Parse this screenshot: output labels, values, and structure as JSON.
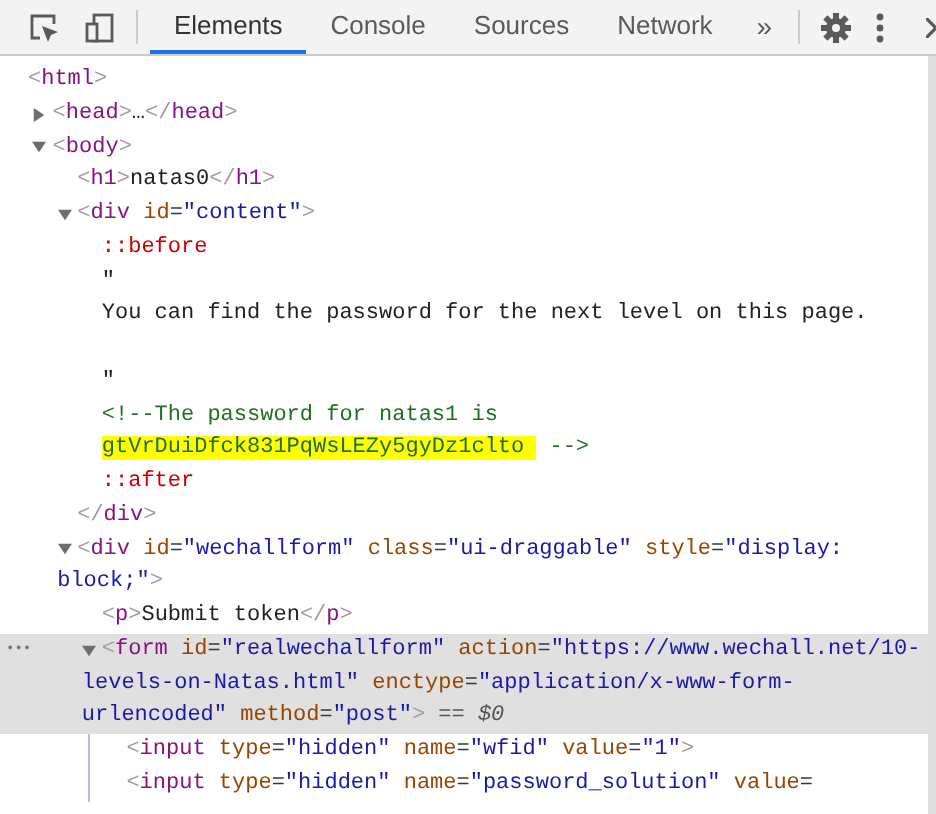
{
  "toolbar": {
    "tabs": [
      {
        "label": "Elements",
        "selected": true
      },
      {
        "label": "Console",
        "selected": false
      },
      {
        "label": "Sources",
        "selected": false
      },
      {
        "label": "Network",
        "selected": false
      }
    ],
    "overflow": "»"
  },
  "tree": [
    {
      "selected": false,
      "lines": [
        [
          {
            "kind": "punct",
            "text": "<"
          },
          {
            "kind": "tag",
            "text": "html"
          },
          {
            "kind": "punct",
            "text": ">"
          }
        ]
      ],
      "children": [
        {
          "selected": false,
          "expanded": false,
          "lines": [
            [
              {
                "kind": "punct",
                "text": "<"
              },
              {
                "kind": "tag",
                "text": "head"
              },
              {
                "kind": "punct",
                "text": ">"
              },
              {
                "kind": "text",
                "text": "…"
              },
              {
                "kind": "punct",
                "text": "</"
              },
              {
                "kind": "tag",
                "text": "head"
              },
              {
                "kind": "punct",
                "text": ">"
              }
            ]
          ]
        },
        {
          "selected": false,
          "expanded": true,
          "lines": [
            [
              {
                "kind": "punct",
                "text": "<"
              },
              {
                "kind": "tag",
                "text": "body"
              },
              {
                "kind": "punct",
                "text": ">"
              }
            ]
          ],
          "children": [
            {
              "selected": false,
              "lines": [
                [
                  {
                    "kind": "punct",
                    "text": "<"
                  },
                  {
                    "kind": "tag",
                    "text": "h1"
                  },
                  {
                    "kind": "punct",
                    "text": ">"
                  },
                  {
                    "kind": "text",
                    "text": "natas0"
                  },
                  {
                    "kind": "punct",
                    "text": "</"
                  },
                  {
                    "kind": "tag",
                    "text": "h1"
                  },
                  {
                    "kind": "punct",
                    "text": ">"
                  }
                ]
              ]
            },
            {
              "selected": false,
              "expanded": true,
              "lines": [
                [
                  {
                    "kind": "punct",
                    "text": "<"
                  },
                  {
                    "kind": "tag",
                    "text": "div "
                  },
                  {
                    "kind": "attr",
                    "text": "id"
                  },
                  {
                    "kind": "eq",
                    "text": "="
                  },
                  {
                    "kind": "value",
                    "text": "\"content\""
                  },
                  {
                    "kind": "punct",
                    "text": ">"
                  }
                ]
              ],
              "children": [
                {
                  "selected": false,
                  "lines": [
                    [
                      {
                        "kind": "pseudo",
                        "text": "::before"
                      }
                    ]
                  ]
                },
                {
                  "selected": false,
                  "trailing_newline": true,
                  "lines": [
                    [
                      {
                        "kind": "text",
                        "text": "\""
                      }
                    ],
                    [
                      {
                        "kind": "text",
                        "text": "You can find the password for the next level on this page."
                      }
                    ],
                    [
                      {
                        "kind": "text",
                        "text": "\""
                      }
                    ]
                  ]
                },
                {
                  "selected": false,
                  "lines": [
                    [
                      {
                        "kind": "comment",
                        "text": "<!--The password for natas1 is"
                      }
                    ],
                    [
                      {
                        "kind": "comment",
                        "text": "gtVrDuiDfck831PqWsLEZy5gyDz1clto",
                        "highlighted": true
                      },
                      {
                        "kind": "comment",
                        "text": " -->"
                      }
                    ]
                  ]
                },
                {
                  "selected": false,
                  "lines": [
                    [
                      {
                        "kind": "pseudo",
                        "text": "::after"
                      }
                    ]
                  ]
                }
              ],
              "closing": [
                {
                  "kind": "punct",
                  "text": "</"
                },
                {
                  "kind": "tag",
                  "text": "div"
                },
                {
                  "kind": "punct",
                  "text": ">"
                }
              ]
            },
            {
              "selected": false,
              "expanded": true,
              "lines": [
                [
                  {
                    "kind": "punct",
                    "text": "<"
                  },
                  {
                    "kind": "tag",
                    "text": "div "
                  },
                  {
                    "kind": "attr",
                    "text": "id"
                  },
                  {
                    "kind": "eq",
                    "text": "="
                  },
                  {
                    "kind": "value",
                    "text": "\"wechallform\" "
                  },
                  {
                    "kind": "attr",
                    "text": "class"
                  },
                  {
                    "kind": "eq",
                    "text": "="
                  },
                  {
                    "kind": "value",
                    "text": "\"ui-draggable\" "
                  },
                  {
                    "kind": "attr",
                    "text": "style"
                  },
                  {
                    "kind": "eq",
                    "text": "="
                  },
                  {
                    "kind": "value",
                    "text": "\"display:"
                  }
                ],
                [
                  {
                    "kind": "value",
                    "text": "block;\""
                  },
                  {
                    "kind": "punct",
                    "text": ">"
                  }
                ]
              ],
              "children": [
                {
                  "selected": false,
                  "lines": [
                    [
                      {
                        "kind": "punct",
                        "text": "<"
                      },
                      {
                        "kind": "tag",
                        "text": "p"
                      },
                      {
                        "kind": "punct",
                        "text": ">"
                      },
                      {
                        "kind": "text",
                        "text": "Submit token"
                      },
                      {
                        "kind": "punct",
                        "text": "</"
                      },
                      {
                        "kind": "tag",
                        "text": "p"
                      },
                      {
                        "kind": "punct",
                        "text": ">"
                      }
                    ]
                  ]
                },
                {
                  "selected": true,
                  "expanded": true,
                  "more": "•••",
                  "lines": [
                    [
                      {
                        "kind": "punct",
                        "text": "<"
                      },
                      {
                        "kind": "tag",
                        "text": "form "
                      },
                      {
                        "kind": "attr",
                        "text": "id"
                      },
                      {
                        "kind": "eq",
                        "text": "="
                      },
                      {
                        "kind": "value",
                        "text": "\"realwechallform\" "
                      },
                      {
                        "kind": "attr",
                        "text": "action"
                      },
                      {
                        "kind": "eq",
                        "text": "="
                      },
                      {
                        "kind": "value",
                        "text": "\"https://www.wechall.net/10-"
                      }
                    ],
                    [
                      {
                        "kind": "value",
                        "text": "levels-on-Natas.html\" "
                      },
                      {
                        "kind": "attr",
                        "text": "enctype"
                      },
                      {
                        "kind": "eq",
                        "text": "="
                      },
                      {
                        "kind": "value",
                        "text": "\"application/x-www-form-"
                      }
                    ],
                    [
                      {
                        "kind": "value",
                        "text": "urlencoded\" "
                      },
                      {
                        "kind": "attr",
                        "text": "method"
                      },
                      {
                        "kind": "eq",
                        "text": "="
                      },
                      {
                        "kind": "value",
                        "text": "\"post\""
                      },
                      {
                        "kind": "punct",
                        "text": ">"
                      },
                      {
                        "kind": "hint",
                        "text": " == "
                      },
                      {
                        "kind": "var",
                        "text": "$0"
                      }
                    ]
                  ],
                  "children": [
                    {
                      "selected": false,
                      "lines": [
                        [
                          {
                            "kind": "punct",
                            "text": "<"
                          },
                          {
                            "kind": "tag",
                            "text": "input "
                          },
                          {
                            "kind": "attr",
                            "text": "type"
                          },
                          {
                            "kind": "eq",
                            "text": "="
                          },
                          {
                            "kind": "value",
                            "text": "\"hidden\" "
                          },
                          {
                            "kind": "attr",
                            "text": "name"
                          },
                          {
                            "kind": "eq",
                            "text": "="
                          },
                          {
                            "kind": "value",
                            "text": "\"wfid\" "
                          },
                          {
                            "kind": "attr",
                            "text": "value"
                          },
                          {
                            "kind": "eq",
                            "text": "="
                          },
                          {
                            "kind": "value",
                            "text": "\"1\""
                          },
                          {
                            "kind": "punct",
                            "text": ">"
                          }
                        ]
                      ]
                    },
                    {
                      "selected": false,
                      "lines": [
                        [
                          {
                            "kind": "punct",
                            "text": "<"
                          },
                          {
                            "kind": "tag",
                            "text": "input "
                          },
                          {
                            "kind": "attr",
                            "text": "type"
                          },
                          {
                            "kind": "eq",
                            "text": "="
                          },
                          {
                            "kind": "value",
                            "text": "\"hidden\" "
                          },
                          {
                            "kind": "attr",
                            "text": "name"
                          },
                          {
                            "kind": "eq",
                            "text": "="
                          },
                          {
                            "kind": "value",
                            "text": "\"password_solution\" "
                          },
                          {
                            "kind": "attr",
                            "text": "value"
                          },
                          {
                            "kind": "eq",
                            "text": "="
                          }
                        ]
                      ]
                    }
                  ]
                }
              ]
            }
          ]
        }
      ]
    }
  ]
}
